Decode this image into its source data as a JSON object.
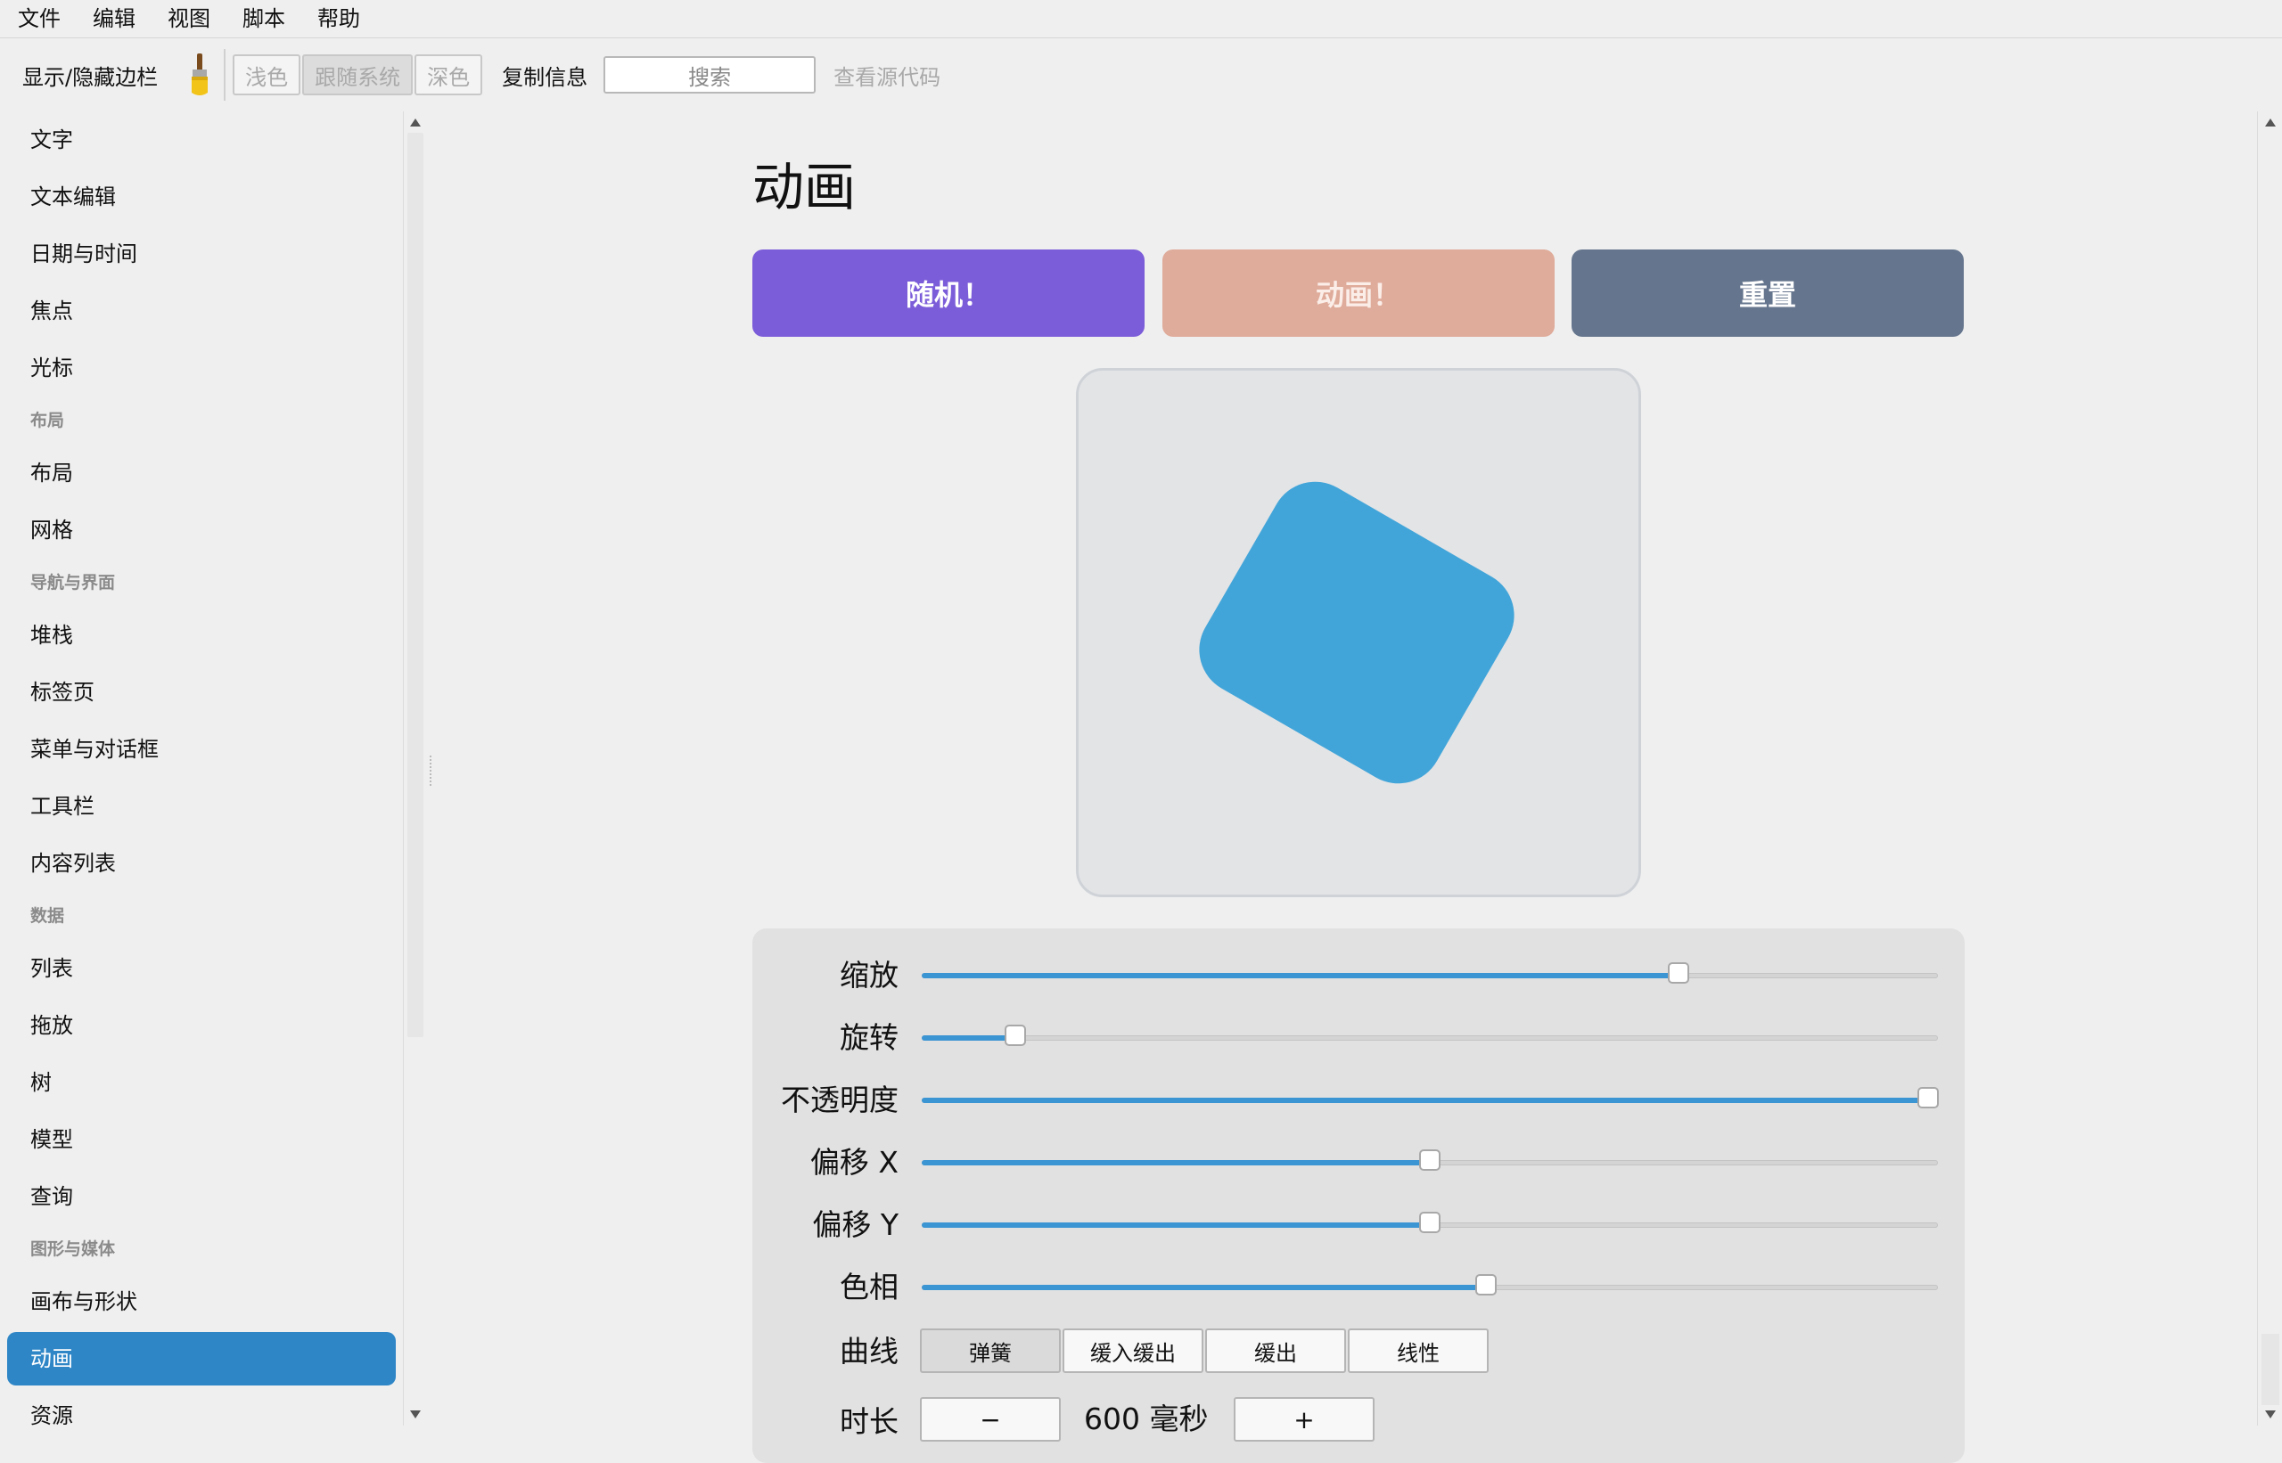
{
  "menubar": {
    "items": [
      "文件",
      "编辑",
      "视图",
      "脚本",
      "帮助"
    ]
  },
  "toolbar": {
    "toggle_sidebar": "显示/隐藏边栏",
    "theme": {
      "light": "浅色",
      "system": "跟随系统",
      "dark": "深色",
      "selected": "跟随系统"
    },
    "copy_info": "复制信息",
    "search_placeholder": "搜索",
    "view_source": "查看源代码"
  },
  "sidebar": {
    "entries": [
      {
        "type": "item",
        "label": "文字"
      },
      {
        "type": "item",
        "label": "文本编辑"
      },
      {
        "type": "item",
        "label": "日期与时间"
      },
      {
        "type": "item",
        "label": "焦点"
      },
      {
        "type": "item",
        "label": "光标"
      },
      {
        "type": "section",
        "label": "布局"
      },
      {
        "type": "item",
        "label": "布局"
      },
      {
        "type": "item",
        "label": "网格"
      },
      {
        "type": "section",
        "label": "导航与界面"
      },
      {
        "type": "item",
        "label": "堆栈"
      },
      {
        "type": "item",
        "label": "标签页"
      },
      {
        "type": "item",
        "label": "菜单与对话框"
      },
      {
        "type": "item",
        "label": "工具栏"
      },
      {
        "type": "item",
        "label": "内容列表"
      },
      {
        "type": "section",
        "label": "数据"
      },
      {
        "type": "item",
        "label": "列表"
      },
      {
        "type": "item",
        "label": "拖放"
      },
      {
        "type": "item",
        "label": "树"
      },
      {
        "type": "item",
        "label": "模型"
      },
      {
        "type": "item",
        "label": "查询"
      },
      {
        "type": "section",
        "label": "图形与媒体"
      },
      {
        "type": "item",
        "label": "画布与形状"
      },
      {
        "type": "item",
        "label": "动画",
        "selected": true
      },
      {
        "type": "item",
        "label": "资源"
      }
    ]
  },
  "main": {
    "title": "动画",
    "buttons": {
      "random": "随机！",
      "animate": "动画！",
      "reset": "重置"
    },
    "shape_color": "#42a5d9",
    "controls": {
      "scale": {
        "label": "缩放",
        "value": 0.745
      },
      "rotate": {
        "label": "旋转",
        "value": 0.092
      },
      "opacity": {
        "label": "不透明度",
        "value": 0.99
      },
      "offset_x": {
        "label": "偏移 X",
        "value": 0.5
      },
      "offset_y": {
        "label": "偏移 Y",
        "value": 0.5
      },
      "hue": {
        "label": "色相",
        "value": 0.555
      }
    },
    "curve": {
      "label": "曲线",
      "options": [
        "弹簧",
        "缓入缓出",
        "缓出",
        "线性"
      ],
      "selected": "弹簧"
    },
    "duration": {
      "label": "时长",
      "minus": "−",
      "value": "600 毫秒",
      "plus": "+"
    }
  },
  "colors": {
    "accent": "#2e86c7",
    "random_button": "#7c5dd9",
    "animate_button": "#dfab9a",
    "reset_button": "#65758d",
    "slider_fill": "#3b95d3"
  }
}
